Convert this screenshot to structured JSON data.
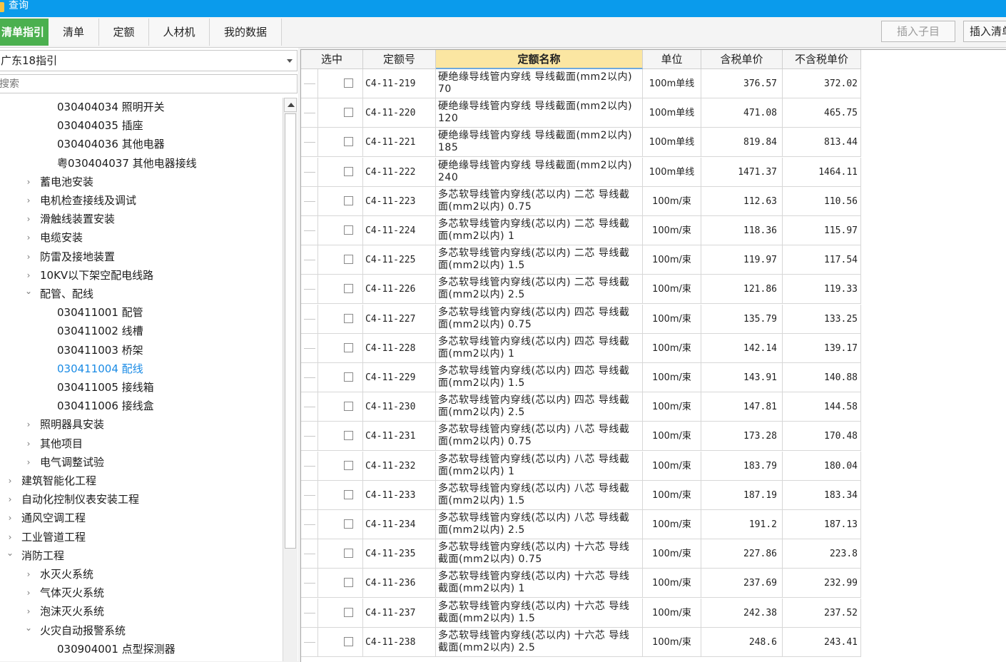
{
  "window": {
    "title": "查询"
  },
  "tabs": [
    {
      "label": "清单指引",
      "active": true
    },
    {
      "label": "清单"
    },
    {
      "label": "定额"
    },
    {
      "label": "人材机"
    },
    {
      "label": "我的数据"
    }
  ],
  "toolbar": {
    "insert_child_label": "插入子目",
    "insert_list_label": "插入清单"
  },
  "left": {
    "combo_value": "广东18指引",
    "search_placeholder": "搜索",
    "tree": [
      {
        "label": "030404034  照明开关",
        "level": 2
      },
      {
        "label": "030404035  插座",
        "level": 2
      },
      {
        "label": "030404036  其他电器",
        "level": 2
      },
      {
        "label": "粤030404037  其他电器接线",
        "level": 2
      },
      {
        "label": "蓄电池安装",
        "level": 1,
        "state": "collapsed"
      },
      {
        "label": "电机检查接线及调试",
        "level": 1,
        "state": "collapsed"
      },
      {
        "label": "滑触线装置安装",
        "level": 1,
        "state": "collapsed"
      },
      {
        "label": "电缆安装",
        "level": 1,
        "state": "collapsed"
      },
      {
        "label": "防雷及接地装置",
        "level": 1,
        "state": "collapsed"
      },
      {
        "label": "10KV以下架空配电线路",
        "level": 1,
        "state": "collapsed"
      },
      {
        "label": "配管、配线",
        "level": 1,
        "state": "expanded"
      },
      {
        "label": "030411001  配管",
        "level": 2
      },
      {
        "label": "030411002  线槽",
        "level": 2
      },
      {
        "label": "030411003  桥架",
        "level": 2
      },
      {
        "label": "030411004  配线",
        "level": 2,
        "selected": true
      },
      {
        "label": "030411005  接线箱",
        "level": 2
      },
      {
        "label": "030411006  接线盒",
        "level": 2
      },
      {
        "label": "照明器具安装",
        "level": 1,
        "state": "collapsed"
      },
      {
        "label": "其他项目",
        "level": 1,
        "state": "collapsed"
      },
      {
        "label": "电气调整试验",
        "level": 1,
        "state": "collapsed"
      },
      {
        "label": "建筑智能化工程",
        "level": 0,
        "state": "collapsed"
      },
      {
        "label": "自动化控制仪表安装工程",
        "level": 0,
        "state": "collapsed"
      },
      {
        "label": "通风空调工程",
        "level": 0,
        "state": "collapsed"
      },
      {
        "label": "工业管道工程",
        "level": 0,
        "state": "collapsed"
      },
      {
        "label": "消防工程",
        "level": 0,
        "state": "expanded"
      },
      {
        "label": "水灭火系统",
        "level": 1,
        "state": "collapsed"
      },
      {
        "label": "气体灭火系统",
        "level": 1,
        "state": "collapsed"
      },
      {
        "label": "泡沫灭火系统",
        "level": 1,
        "state": "collapsed"
      },
      {
        "label": "火灾自动报警系统",
        "level": 1,
        "state": "expanded"
      },
      {
        "label": "030904001  点型探测器",
        "level": 2
      }
    ]
  },
  "grid": {
    "columns": [
      "选中",
      "定额号",
      "定额名称",
      "单位",
      "含税单价",
      "不含税单价"
    ],
    "sorted_column": "定额名称",
    "rows": [
      {
        "code": "C4-11-219",
        "name": "硬绝缘导线管内穿线 导线截面(mm2以内) 70",
        "unit": "100m单线",
        "price_tax": "376.57",
        "price_notax": "372.02"
      },
      {
        "code": "C4-11-220",
        "name": "硬绝缘导线管内穿线 导线截面(mm2以内) 120",
        "unit": "100m单线",
        "price_tax": "471.08",
        "price_notax": "465.75"
      },
      {
        "code": "C4-11-221",
        "name": "硬绝缘导线管内穿线 导线截面(mm2以内) 185",
        "unit": "100m单线",
        "price_tax": "819.84",
        "price_notax": "813.44"
      },
      {
        "code": "C4-11-222",
        "name": "硬绝缘导线管内穿线 导线截面(mm2以内) 240",
        "unit": "100m单线",
        "price_tax": "1471.37",
        "price_notax": "1464.11"
      },
      {
        "code": "C4-11-223",
        "name": "多芯软导线管内穿线(芯以内) 二芯 导线截面(mm2以内) 0.75",
        "unit": "100m/束",
        "price_tax": "112.63",
        "price_notax": "110.56"
      },
      {
        "code": "C4-11-224",
        "name": "多芯软导线管内穿线(芯以内) 二芯 导线截面(mm2以内) 1",
        "unit": "100m/束",
        "price_tax": "118.36",
        "price_notax": "115.97"
      },
      {
        "code": "C4-11-225",
        "name": "多芯软导线管内穿线(芯以内) 二芯 导线截面(mm2以内) 1.5",
        "unit": "100m/束",
        "price_tax": "119.97",
        "price_notax": "117.54"
      },
      {
        "code": "C4-11-226",
        "name": "多芯软导线管内穿线(芯以内) 二芯 导线截面(mm2以内) 2.5",
        "unit": "100m/束",
        "price_tax": "121.86",
        "price_notax": "119.33"
      },
      {
        "code": "C4-11-227",
        "name": "多芯软导线管内穿线(芯以内) 四芯 导线截面(mm2以内) 0.75",
        "unit": "100m/束",
        "price_tax": "135.79",
        "price_notax": "133.25"
      },
      {
        "code": "C4-11-228",
        "name": "多芯软导线管内穿线(芯以内) 四芯 导线截面(mm2以内) 1",
        "unit": "100m/束",
        "price_tax": "142.14",
        "price_notax": "139.17"
      },
      {
        "code": "C4-11-229",
        "name": "多芯软导线管内穿线(芯以内) 四芯 导线截面(mm2以内) 1.5",
        "unit": "100m/束",
        "price_tax": "143.91",
        "price_notax": "140.88"
      },
      {
        "code": "C4-11-230",
        "name": "多芯软导线管内穿线(芯以内) 四芯 导线截面(mm2以内) 2.5",
        "unit": "100m/束",
        "price_tax": "147.81",
        "price_notax": "144.58"
      },
      {
        "code": "C4-11-231",
        "name": "多芯软导线管内穿线(芯以内) 八芯 导线截面(mm2以内) 0.75",
        "unit": "100m/束",
        "price_tax": "173.28",
        "price_notax": "170.48"
      },
      {
        "code": "C4-11-232",
        "name": "多芯软导线管内穿线(芯以内) 八芯 导线截面(mm2以内) 1",
        "unit": "100m/束",
        "price_tax": "183.79",
        "price_notax": "180.04"
      },
      {
        "code": "C4-11-233",
        "name": "多芯软导线管内穿线(芯以内) 八芯 导线截面(mm2以内) 1.5",
        "unit": "100m/束",
        "price_tax": "187.19",
        "price_notax": "183.34"
      },
      {
        "code": "C4-11-234",
        "name": "多芯软导线管内穿线(芯以内) 八芯 导线截面(mm2以内) 2.5",
        "unit": "100m/束",
        "price_tax": "191.2",
        "price_notax": "187.13"
      },
      {
        "code": "C4-11-235",
        "name": "多芯软导线管内穿线(芯以内) 十六芯 导线截面(mm2以内) 0.75",
        "unit": "100m/束",
        "price_tax": "227.86",
        "price_notax": "223.8"
      },
      {
        "code": "C4-11-236",
        "name": "多芯软导线管内穿线(芯以内) 十六芯 导线截面(mm2以内) 1",
        "unit": "100m/束",
        "price_tax": "237.69",
        "price_notax": "232.99"
      },
      {
        "code": "C4-11-237",
        "name": "多芯软导线管内穿线(芯以内) 十六芯 导线截面(mm2以内) 1.5",
        "unit": "100m/束",
        "price_tax": "242.38",
        "price_notax": "237.52"
      },
      {
        "code": "C4-11-238",
        "name": "多芯软导线管内穿线(芯以内) 十六芯 导线截面(mm2以内) 2.5",
        "unit": "100m/束",
        "price_tax": "248.6",
        "price_notax": "243.41"
      }
    ]
  }
}
